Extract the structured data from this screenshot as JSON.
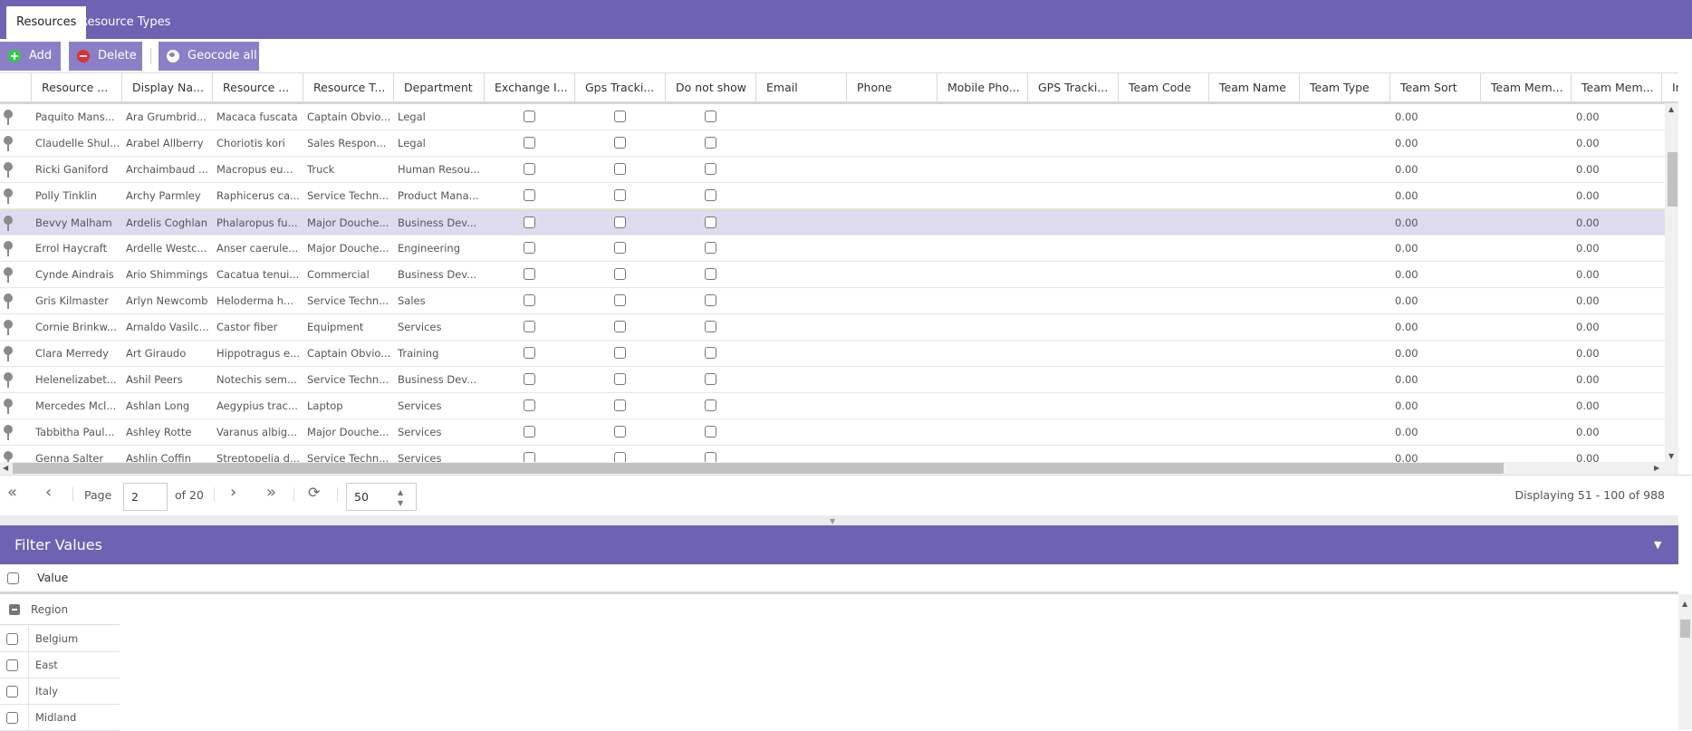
{
  "tabs": [
    {
      "label": "Resources",
      "active": true
    },
    {
      "label": "Resource Types",
      "active": false
    }
  ],
  "toolbar": {
    "add": "Add",
    "delete": "Delete",
    "geocode": "Geocode all"
  },
  "colors": {
    "header": "#6e62b2",
    "button": "#8b80c7",
    "selected_row": "#dedbee"
  },
  "columns": [
    "Resource ...",
    "Display Na...",
    "Resource ...",
    "Resource T...",
    "Department",
    "Exchange I...",
    "Gps Tracki...",
    "Do not show",
    "Email",
    "Phone",
    "Mobile Pho...",
    "GPS Tracki...",
    "Team Code",
    "Team Name",
    "Team Type",
    "Team Sort",
    "Team Mem...",
    "Team Mem...",
    "In S"
  ],
  "rows": [
    {
      "name": "Paquito Mans...",
      "display": "Ara Grumbrid...",
      "resource": "Macaca fuscata",
      "type": "Captain Obvio...",
      "dept": "Legal",
      "team_sort": "0.00",
      "team_mem": "0.00"
    },
    {
      "name": "Claudelle Shul...",
      "display": "Arabel Allberry",
      "resource": "Choriotis kori",
      "type": "Sales Respon...",
      "dept": "Legal",
      "team_sort": "0.00",
      "team_mem": "0.00"
    },
    {
      "name": "Ricki Ganiford",
      "display": "Archaimbaud ...",
      "resource": "Macropus eu...",
      "type": "Truck",
      "dept": "Human Resou...",
      "team_sort": "0.00",
      "team_mem": "0.00"
    },
    {
      "name": "Polly Tinklin",
      "display": "Archy Parmley",
      "resource": "Raphicerus ca...",
      "type": "Service Techn...",
      "dept": "Product Mana...",
      "team_sort": "0.00",
      "team_mem": "0.00"
    },
    {
      "name": "Bevvy Malham",
      "display": "Ardelis Coghlan",
      "resource": "Phalaropus fu...",
      "type": "Major Douche...",
      "dept": "Business Dev...",
      "team_sort": "0.00",
      "team_mem": "0.00",
      "selected": true
    },
    {
      "name": "Errol Haycraft",
      "display": "Ardelle Westc...",
      "resource": "Anser caerule...",
      "type": "Major Douche...",
      "dept": "Engineering",
      "team_sort": "0.00",
      "team_mem": "0.00"
    },
    {
      "name": "Cynde Aindrais",
      "display": "Ario Shimmings",
      "resource": "Cacatua tenui...",
      "type": "Commercial",
      "dept": "Business Dev...",
      "team_sort": "0.00",
      "team_mem": "0.00"
    },
    {
      "name": "Gris Kilmaster",
      "display": "Arlyn Newcomb",
      "resource": "Heloderma h...",
      "type": "Service Techn...",
      "dept": "Sales",
      "team_sort": "0.00",
      "team_mem": "0.00"
    },
    {
      "name": "Cornie Brinkw...",
      "display": "Arnaldo Vasilc...",
      "resource": "Castor fiber",
      "type": "Equipment",
      "dept": "Services",
      "team_sort": "0.00",
      "team_mem": "0.00"
    },
    {
      "name": "Clara Merredy",
      "display": "Art Giraudo",
      "resource": "Hippotragus e...",
      "type": "Captain Obvio...",
      "dept": "Training",
      "team_sort": "0.00",
      "team_mem": "0.00"
    },
    {
      "name": "Helenelizabet...",
      "display": "Ashil Peers",
      "resource": "Notechis sem...",
      "type": "Service Techn...",
      "dept": "Business Dev...",
      "team_sort": "0.00",
      "team_mem": "0.00"
    },
    {
      "name": "Mercedes Mcl...",
      "display": "Ashlan Long",
      "resource": "Aegypius trac...",
      "type": "Laptop",
      "dept": "Services",
      "team_sort": "0.00",
      "team_mem": "0.00"
    },
    {
      "name": "Tabbitha Paul...",
      "display": "Ashley Rotte",
      "resource": "Varanus albig...",
      "type": "Major Douche...",
      "dept": "Services",
      "team_sort": "0.00",
      "team_mem": "0.00"
    },
    {
      "name": "Genna Salter",
      "display": "Ashlin Coffin",
      "resource": "Streptopelia d...",
      "type": "Service Techn...",
      "dept": "Services",
      "team_sort": "0.00",
      "team_mem": "0.00"
    }
  ],
  "pager": {
    "page_label": "Page",
    "page": "2",
    "of": "of 20",
    "page_size": "50",
    "displaying": "Displaying 51 - 100 of 988"
  },
  "filter": {
    "title": "Filter Values",
    "value_header": "Value",
    "group": "Region",
    "items": [
      "Belgium",
      "East",
      "Italy",
      "Midland"
    ]
  }
}
